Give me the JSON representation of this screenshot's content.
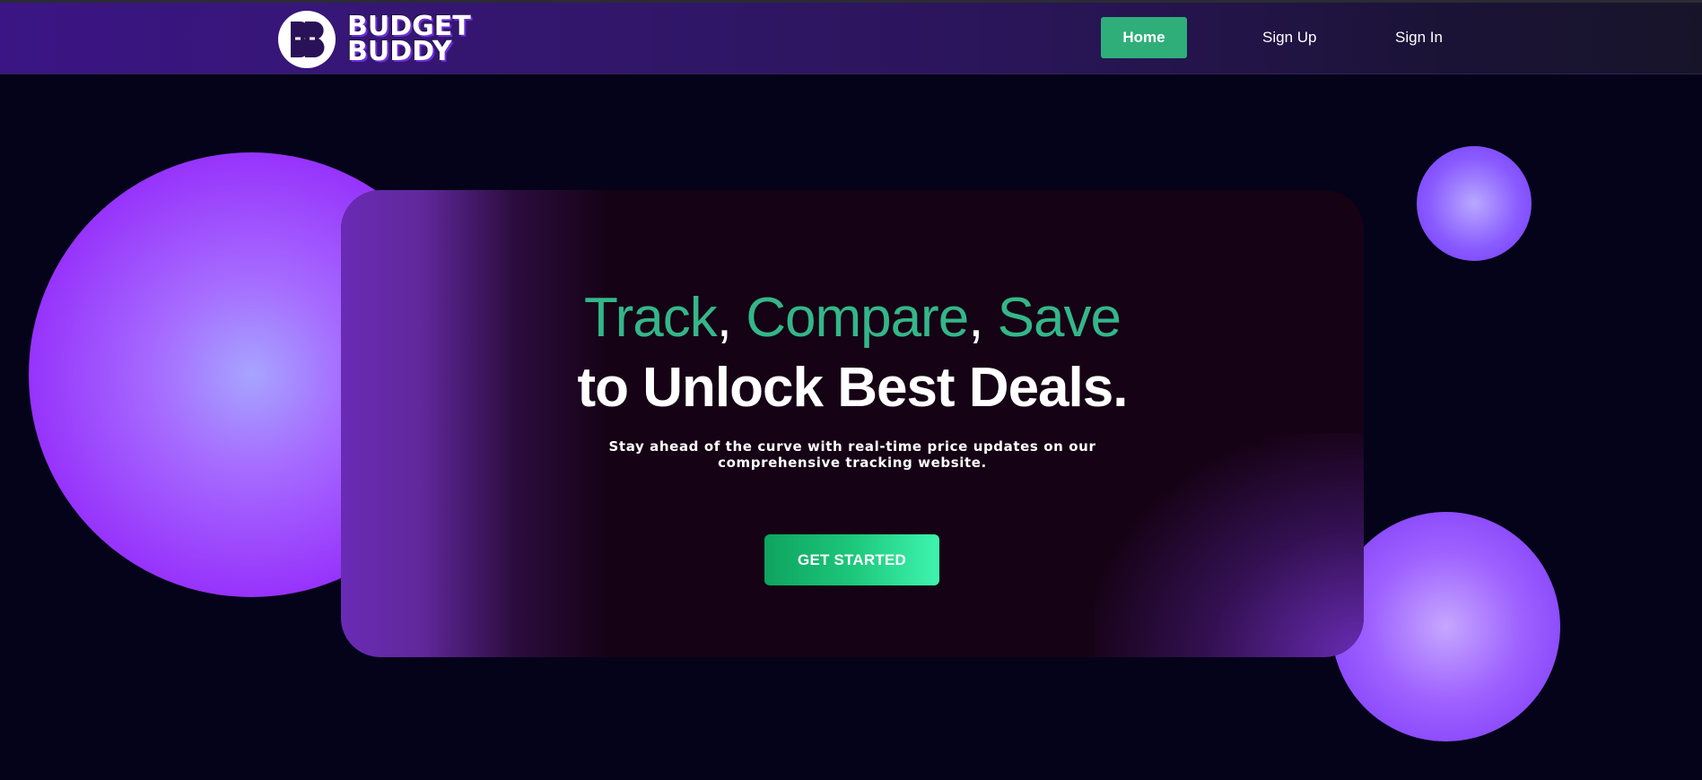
{
  "brand": {
    "line1": "BUDGET",
    "line2": "BUDDY",
    "logo_icon": "bb-monogram-icon"
  },
  "nav": {
    "home": "Home",
    "sign_up": "Sign Up",
    "sign_in": "Sign In"
  },
  "hero": {
    "title_word1": "Track",
    "title_sep1": ", ",
    "title_word2": "Compare",
    "title_sep2": ", ",
    "title_word3": "Save",
    "title_line2": "to Unlock Best Deals.",
    "subtitle_line1": "Stay ahead of the curve with real-time price updates on our",
    "subtitle_line2": "comprehensive tracking website.",
    "cta_label": "GET STARTED"
  },
  "colors": {
    "accent_green": "#34b689",
    "nav_home_bg": "#2fae7a",
    "background": "#05031a",
    "card_bg": "#150214",
    "sphere_purple": "#952dfb"
  }
}
